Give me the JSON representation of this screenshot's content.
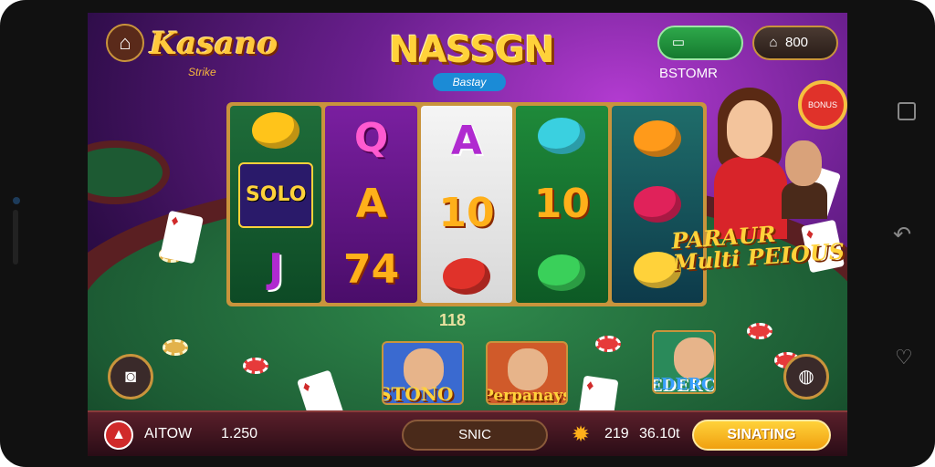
{
  "header": {
    "home_icon": "home-icon",
    "logo": "Kasano",
    "logo_sub": "Strike",
    "title": "NASSGN",
    "title_sub": "Bastay",
    "pill_green": {
      "icon": "ticket-icon",
      "label": "BSTOMR"
    },
    "pill_dark": {
      "icon": "lock-icon",
      "label": "800"
    }
  },
  "reels": [
    {
      "symbols": [
        {
          "kind": "shape",
          "color": "#ffc41a"
        },
        {
          "kind": "badge",
          "text": "SOLO"
        },
        {
          "kind": "letter2",
          "text": "J"
        }
      ]
    },
    {
      "symbols": [
        {
          "kind": "letter",
          "text": "Q"
        },
        {
          "kind": "num",
          "text": "A"
        },
        {
          "kind": "num",
          "text": "74"
        }
      ]
    },
    {
      "symbols": [
        {
          "kind": "letter2",
          "text": "A"
        },
        {
          "kind": "num",
          "text": "10"
        },
        {
          "kind": "shape",
          "color": "#e0322a"
        }
      ]
    },
    {
      "symbols": [
        {
          "kind": "shape",
          "color": "#3ad0e0"
        },
        {
          "kind": "num",
          "text": "10"
        },
        {
          "kind": "shape",
          "color": "#3ad05a"
        }
      ]
    },
    {
      "symbols": [
        {
          "kind": "shape",
          "color": "#ff9a1a"
        },
        {
          "kind": "shape",
          "color": "#e0225a"
        },
        {
          "kind": "shape",
          "color": "#ffd23a"
        }
      ]
    }
  ],
  "promo": {
    "line1": "PARAUR",
    "line2": "Multi PEIOUS"
  },
  "felt_value": "118",
  "players": [
    {
      "label": "STONO"
    },
    {
      "label": "Perpanays"
    },
    {
      "label": "MEDERCO"
    }
  ],
  "side_buttons": {
    "left": "camera-icon",
    "right": "chip-icon"
  },
  "bottom_bar": {
    "icon": "hat-icon",
    "label": "AITOW",
    "amount": "1.250",
    "mid_button": "SNIC",
    "counter_a": "219",
    "counter_b": "36.10t",
    "action": "SINATING"
  }
}
